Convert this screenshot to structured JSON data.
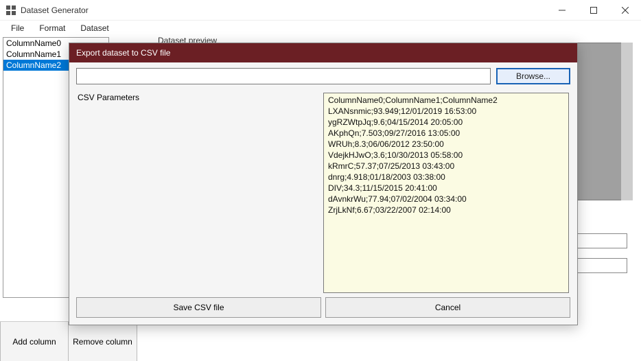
{
  "window": {
    "title": "Dataset Generator"
  },
  "menu": {
    "file": "File",
    "format": "Format",
    "dataset": "Dataset"
  },
  "columns": {
    "items": [
      {
        "label": "ColumnName0"
      },
      {
        "label": "ColumnName1"
      },
      {
        "label": "ColumnName2"
      }
    ],
    "selected_index": 2
  },
  "preview": {
    "label": "Dataset preview"
  },
  "buttons": {
    "add_column": "Add column",
    "remove_column": "Remove column"
  },
  "dialog": {
    "title": "Export dataset to CSV file",
    "path_value": "",
    "browse": "Browse...",
    "parameters_label": "CSV Parameters",
    "csv_text": "ColumnName0;ColumnName1;ColumnName2\nLXANsnmic;93.949;12/01/2019 16:53:00\nygRZWtpJq;9.6;04/15/2014 20:05:00\nAKphQn;7.503;09/27/2016 13:05:00\nWRUh;8.3;06/06/2012 23:50:00\nVdejkHJwO;3.6;10/30/2013 05:58:00\nkRmrC;57.37;07/25/2013 03:43:00\ndnrg;4.918;01/18/2003 03:38:00\nDIV;34.3;11/15/2015 20:41:00\ndAvnkrWu;77.94;07/02/2004 03:34:00\nZrjLkNf;6.67;03/22/2007 02:14:00",
    "save": "Save CSV file",
    "cancel": "Cancel"
  }
}
